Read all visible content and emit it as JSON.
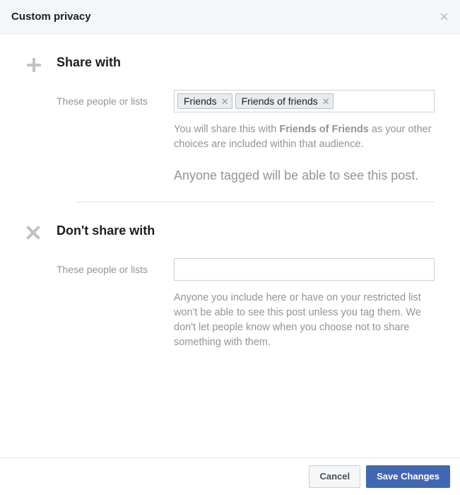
{
  "header": {
    "title": "Custom privacy"
  },
  "shareWith": {
    "title": "Share with",
    "label": "These people or lists",
    "tokens": [
      "Friends",
      "Friends of friends"
    ],
    "helper_pre": "You will share this with ",
    "helper_bold": "Friends of Friends",
    "helper_post": " as your other choices are included within that audience.",
    "tagged_note": "Anyone tagged will be able to see this post."
  },
  "dontShareWith": {
    "title": "Don't share with",
    "label": "These people or lists",
    "helper": "Anyone you include here or have on your restricted list won't be able to see this post unless you tag them. We don't let people know when you choose not to share something with them."
  },
  "footer": {
    "cancel": "Cancel",
    "save": "Save Changes"
  }
}
